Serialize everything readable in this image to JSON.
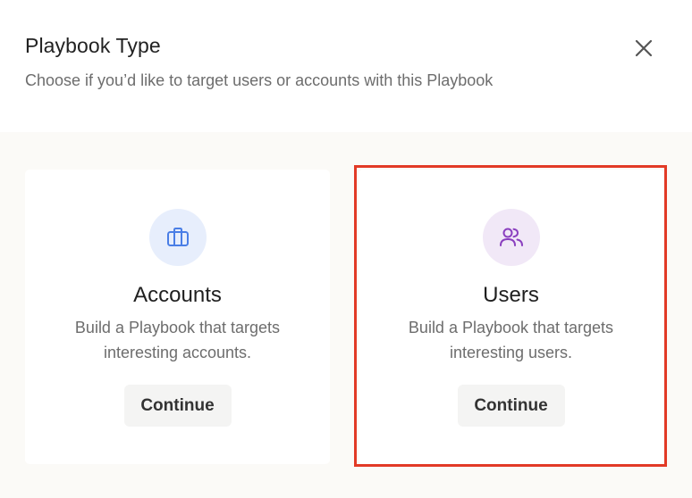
{
  "header": {
    "title": "Playbook Type",
    "subtitle": "Choose if you’d like to target users or accounts with this Playbook",
    "close_icon": "close-icon"
  },
  "cards": [
    {
      "id": "accounts",
      "icon": "briefcase-icon",
      "icon_color": "#4a7ee6",
      "title": "Accounts",
      "description": "Build a Playbook that targets interesting accounts.",
      "button_label": "Continue"
    },
    {
      "id": "users",
      "icon": "users-icon",
      "icon_color": "#8a3fbf",
      "title": "Users",
      "description": "Build a Playbook that targets interesting users.",
      "button_label": "Continue",
      "highlighted": true
    }
  ],
  "colors": {
    "highlight_border": "#e23a26",
    "body_background": "#fbfaf7",
    "button_background": "#f4f4f3"
  }
}
